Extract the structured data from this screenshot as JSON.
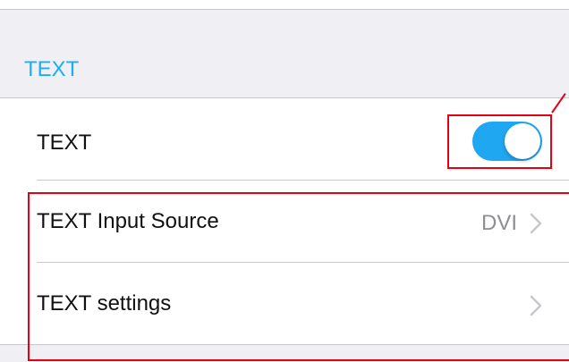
{
  "section": {
    "header_label": "TEXT"
  },
  "rows": {
    "toggle_row": {
      "label": "TEXT",
      "switch_on": true
    },
    "input_source_row": {
      "label": "TEXT Input Source",
      "value": "DVI"
    },
    "settings_row": {
      "label": "TEXT settings"
    }
  },
  "icons": {
    "chevron": "chevron-right-icon"
  },
  "colors": {
    "accent_blue": "#1fa7f2",
    "header_text": "#1ab0f0",
    "annotation_red": "#e60012",
    "secondary_text": "#8e8e93",
    "grouped_background": "#efeff4"
  }
}
